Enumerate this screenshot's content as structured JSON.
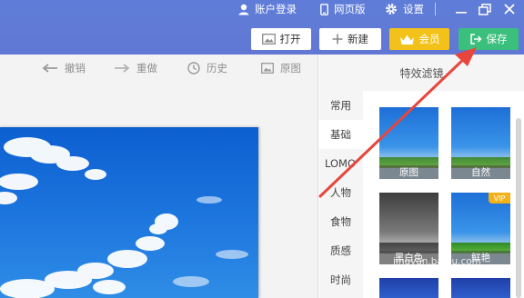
{
  "titlebar": {
    "account_label": "账户登录",
    "mobile_label": "网页版",
    "settings_label": "设置"
  },
  "toolbar": {
    "open_label": "打开",
    "new_label": "新建",
    "vip_label": "会员",
    "save_label": "保存"
  },
  "canvas_tools": {
    "undo_label": "撤销",
    "redo_label": "重做",
    "history_label": "历史",
    "original_label": "原图"
  },
  "panel": {
    "title": "特效滤镜",
    "categories": [
      {
        "label": "常用"
      },
      {
        "label": "基础"
      },
      {
        "label": "LOMO"
      },
      {
        "label": "人物"
      },
      {
        "label": "食物"
      },
      {
        "label": "质感"
      },
      {
        "label": "时尚"
      }
    ],
    "active_category": "基础",
    "filters": [
      {
        "label": "原图"
      },
      {
        "label": "自然"
      },
      {
        "label": "黑白色"
      },
      {
        "label": "鲜艳",
        "badge": "VIP"
      }
    ]
  },
  "watermark": "jingyan.baidu.com",
  "colors": {
    "titlebar": "#6078d3",
    "save_button": "#3bbf7d",
    "vip_button": "#f3c21a",
    "annotation_arrow": "#e8463c"
  }
}
